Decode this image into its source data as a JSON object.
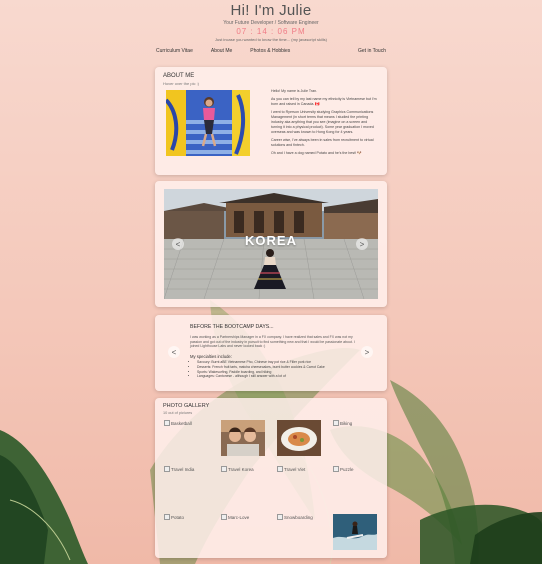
{
  "header": {
    "title": "Hi! I'm Julie",
    "subtitle": "Your Future Developer / Software Engineer",
    "clock": "07 : 14 : 06 PM",
    "note": "Just incase you wanted to know the time... (my javascript skills)"
  },
  "nav": {
    "items": [
      "Curriculum Vitae",
      "About Me",
      "Photos & Hobbies"
    ],
    "right": "Get in Touch"
  },
  "about": {
    "title": "ABOUT ME",
    "tagline": "Hover over the pic :)",
    "paragraphs": [
      "Hello! My name is Julie Tran.",
      "As you can tell by my last name my ethnicity is Vietnamese but I'm born and raised in Canada. 🇨🇦",
      "I went to Ryerson University studying Graphics Communications Management (in short terms that means I studied the printing industry aka anything that you see (imagine on a screen and turning it into a physical product). Some year graduation I moved overseas and was known to Hong Kong for 4 years.",
      "Career wise, I've always been in sales from recruitment to virtual solutions and fintech.",
      "Oh and I have a dog named Potato and he's the best! 🐶"
    ]
  },
  "carousel": {
    "caption": "KOREA",
    "prev": "<",
    "next": ">"
  },
  "bootcamp": {
    "title": "BEFORE THE BOOTCAMP DAYS...",
    "desc": "I was working as a Partnerships Manager in a FX company. I have realized that sales and FX was not my passion and got out of the industry in pursuit to find something new and that I would be passionate about. I joined Lighthouse Labs and never looked back :)",
    "specialties_label": "My specialties include:",
    "specialties": [
      "Savoury: Burnt aBE Vietnamese Pho, Chinese tray pot rice & Filler pork rice",
      "Desserts: French fruit tarts, matcha cheesecakes, burnt butter cookies & Carrot Cake",
      "Sports: Wakesurfing, Paddle boarding, and hiking",
      "Languages: Cantonese - although I still answer with a lot of"
    ],
    "prev": "<",
    "next": ">"
  },
  "gallery": {
    "title": "PHOTO GALLERY",
    "count": "10 out of pictures",
    "cells": [
      {
        "alt": "Basketball",
        "image": false
      },
      {
        "alt": "",
        "image": true,
        "kind": "friends"
      },
      {
        "alt": "",
        "image": true,
        "kind": "food"
      },
      {
        "alt": "Biking",
        "image": false
      },
      {
        "alt": "Travel India",
        "image": false
      },
      {
        "alt": "Travel Korea",
        "image": false
      },
      {
        "alt": "Travel Viet",
        "image": false
      },
      {
        "alt": "Puzzle",
        "image": false
      },
      {
        "alt": "Potato",
        "image": false
      },
      {
        "alt": "Marc-Love",
        "image": false
      },
      {
        "alt": "Snowboarding",
        "image": false
      },
      {
        "alt": "",
        "image": true,
        "kind": "surf"
      }
    ]
  },
  "colors": {
    "clock": "#f07c86",
    "background": "#f6cfc4",
    "card": "#fff0ec"
  }
}
